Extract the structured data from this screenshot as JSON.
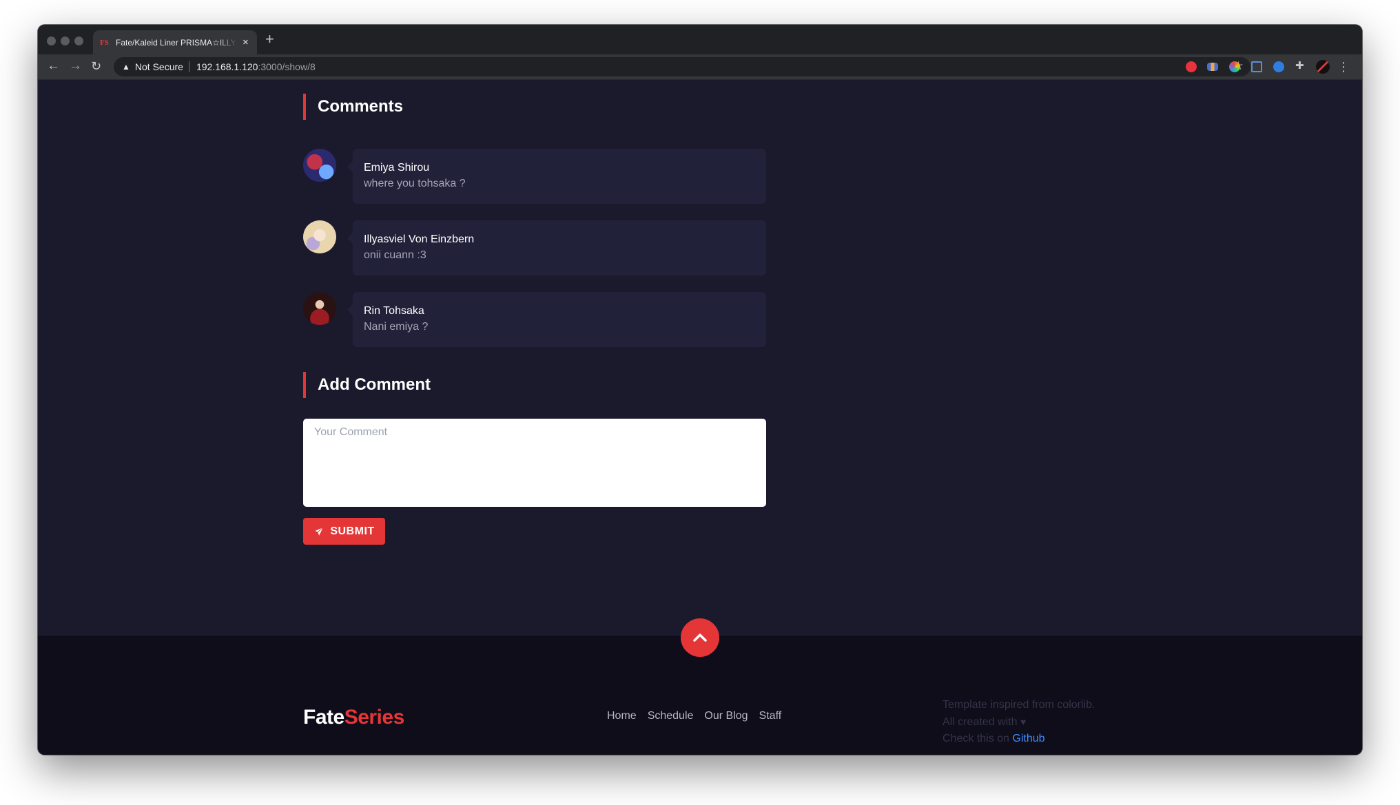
{
  "browser": {
    "tab_title": "Fate/Kaleid Liner PRISMA☆ILLYA",
    "tab_favicon": "FS",
    "new_tab": "+",
    "tab_close": "×",
    "not_secure": "Not Secure",
    "url_host": "192.168.1.120",
    "url_path": ":3000/show/8"
  },
  "comments": {
    "title": "Comments",
    "items": [
      {
        "name": "Emiya Shirou",
        "text": "where you tohsaka ?",
        "avatar_colors": [
          "#2b2a6f",
          "#c2334a",
          "#6ea8ff"
        ]
      },
      {
        "name": "Illyasviel Von Einzbern",
        "text": "onii cuann :3",
        "avatar_colors": [
          "#f3ead9",
          "#e9c98d",
          "#b9a7d8"
        ]
      },
      {
        "name": "Rin Tohsaka",
        "text": "Nani emiya ?",
        "avatar_colors": [
          "#2a1212",
          "#9b1c22",
          "#3b2618"
        ]
      }
    ]
  },
  "add_comment": {
    "title": "Add Comment",
    "placeholder": "Your Comment",
    "submit_label": "SUBMIT"
  },
  "footer": {
    "logo_part1": "Fate",
    "logo_part2": "Series",
    "nav": [
      "Home",
      "Schedule",
      "Our Blog",
      "Staff"
    ],
    "info_line1": "Template inspired from colorlib.",
    "info_line2": "All created with",
    "info_line3_prefix": "Check this on ",
    "info_line3_link": "Github"
  },
  "colors": {
    "accent": "#e53637",
    "page_bg": "#1b1a2d",
    "card_bg": "#22213a",
    "footer_bg": "#0e0d19",
    "link": "#3d8bff"
  }
}
